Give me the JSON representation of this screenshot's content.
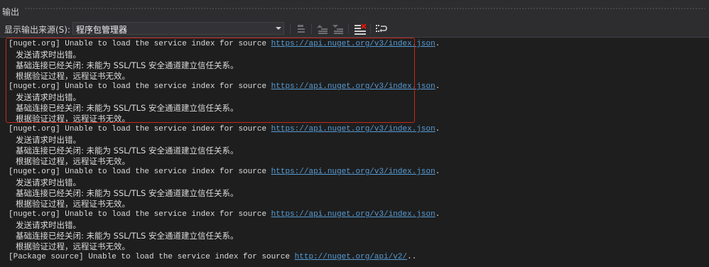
{
  "panel": {
    "title": "输出"
  },
  "toolbar": {
    "source_label": "显示输出来源(S):",
    "source_value": "程序包管理器"
  },
  "entries": [
    {
      "prefix": "[nuget.org] Unable to load the service index for source ",
      "url": "https://api.nuget.org/v3/index.json",
      "suffix": ".",
      "line2": "发送请求时出错。",
      "line3": "基础连接已经关闭: 未能为 SSL/TLS 安全通道建立信任关系。",
      "line4": "根据验证过程，远程证书无效。"
    },
    {
      "prefix": "[nuget.org] Unable to load the service index for source ",
      "url": "https://api.nuget.org/v3/index.json",
      "suffix": ".",
      "line2": "发送请求时出错。",
      "line3": "基础连接已经关闭: 未能为 SSL/TLS 安全通道建立信任关系。",
      "line4": "根据验证过程，远程证书无效。"
    },
    {
      "prefix": "[nuget.org] Unable to load the service index for source ",
      "url": "https://api.nuget.org/v3/index.json",
      "suffix": ".",
      "line2": "发送请求时出错。",
      "line3": "基础连接已经关闭: 未能为 SSL/TLS 安全通道建立信任关系。",
      "line4": "根据验证过程，远程证书无效。"
    },
    {
      "prefix": "[nuget.org] Unable to load the service index for source ",
      "url": "https://api.nuget.org/v3/index.json",
      "suffix": ".",
      "line2": "发送请求时出错。",
      "line3": "基础连接已经关闭: 未能为 SSL/TLS 安全通道建立信任关系。",
      "line4": "根据验证过程，远程证书无效。"
    },
    {
      "prefix": "[nuget.org] Unable to load the service index for source ",
      "url": "https://api.nuget.org/v3/index.json",
      "suffix": ".",
      "line2": "发送请求时出错。",
      "line3": "基础连接已经关闭: 未能为 SSL/TLS 安全通道建立信任关系。",
      "line4": "根据验证过程，远程证书无效。"
    }
  ],
  "last_line": {
    "prefix": "[Package source] Unable to load the service index for source ",
    "url": "http://nuget.org/api/v2/",
    "suffix": ".."
  },
  "colors": {
    "background": "#1e1e1e",
    "link": "#569cd6",
    "highlight_border": "#c42b1c",
    "clear_icon_accent": "#e51400"
  },
  "icons": {
    "go_to_location": "go-to-location-icon",
    "prev_message": "previous-message-icon",
    "next_message": "next-message-icon",
    "clear_all": "clear-all-icon",
    "word_wrap": "word-wrap-icon"
  }
}
